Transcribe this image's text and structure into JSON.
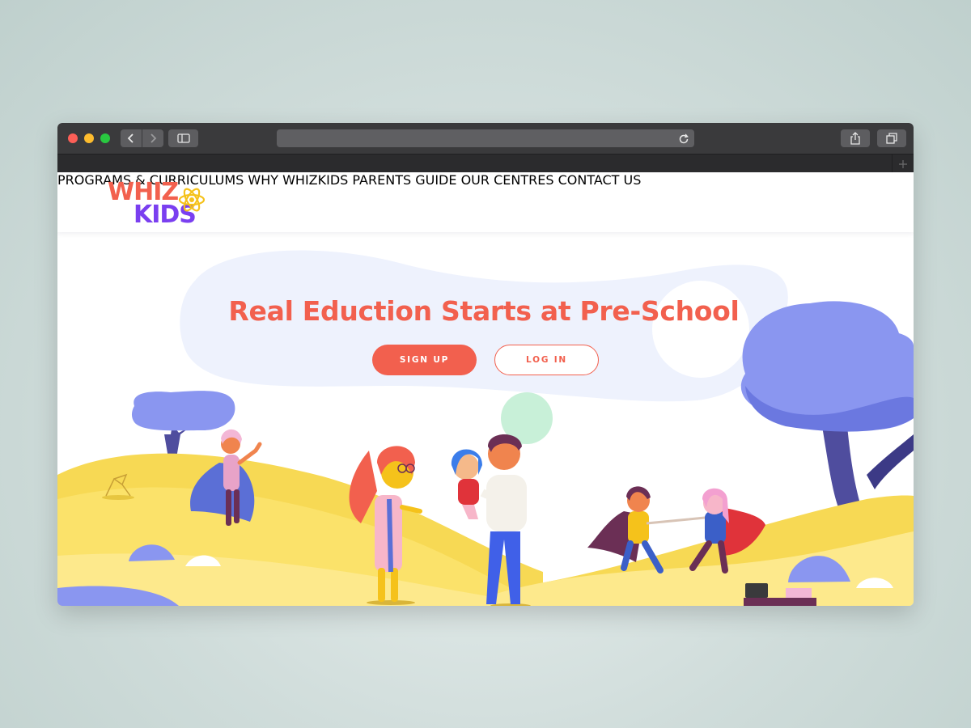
{
  "browser": {
    "icons": {
      "back": "chevron-left-icon",
      "forward": "chevron-right-icon",
      "sidebar": "sidebar-icon",
      "reload": "reload-icon",
      "share": "share-icon",
      "tabs": "tabs-icon",
      "new_tab": "plus-icon"
    }
  },
  "site": {
    "logo": {
      "line1": "WHIZ",
      "line2": "KIDS"
    },
    "nav": [
      {
        "label": "PROGRAMS & CURRICULUMS"
      },
      {
        "label": "WHY WHIZKIDS"
      },
      {
        "label": "PARENTS GUIDE"
      },
      {
        "label": "OUR CENTRES"
      },
      {
        "label": "CONTACT US"
      }
    ],
    "hero": {
      "headline": "Real Eduction Starts at Pre-School",
      "signup_label": "SIGN UP",
      "login_label": "LOG IN"
    },
    "colors": {
      "brand_coral": "#f2604e",
      "brand_purple": "#7a3ff0",
      "nav_text": "#4a4fb0",
      "hill_yellow": "#fbe26a",
      "tree_blue": "#8a96f0"
    }
  }
}
